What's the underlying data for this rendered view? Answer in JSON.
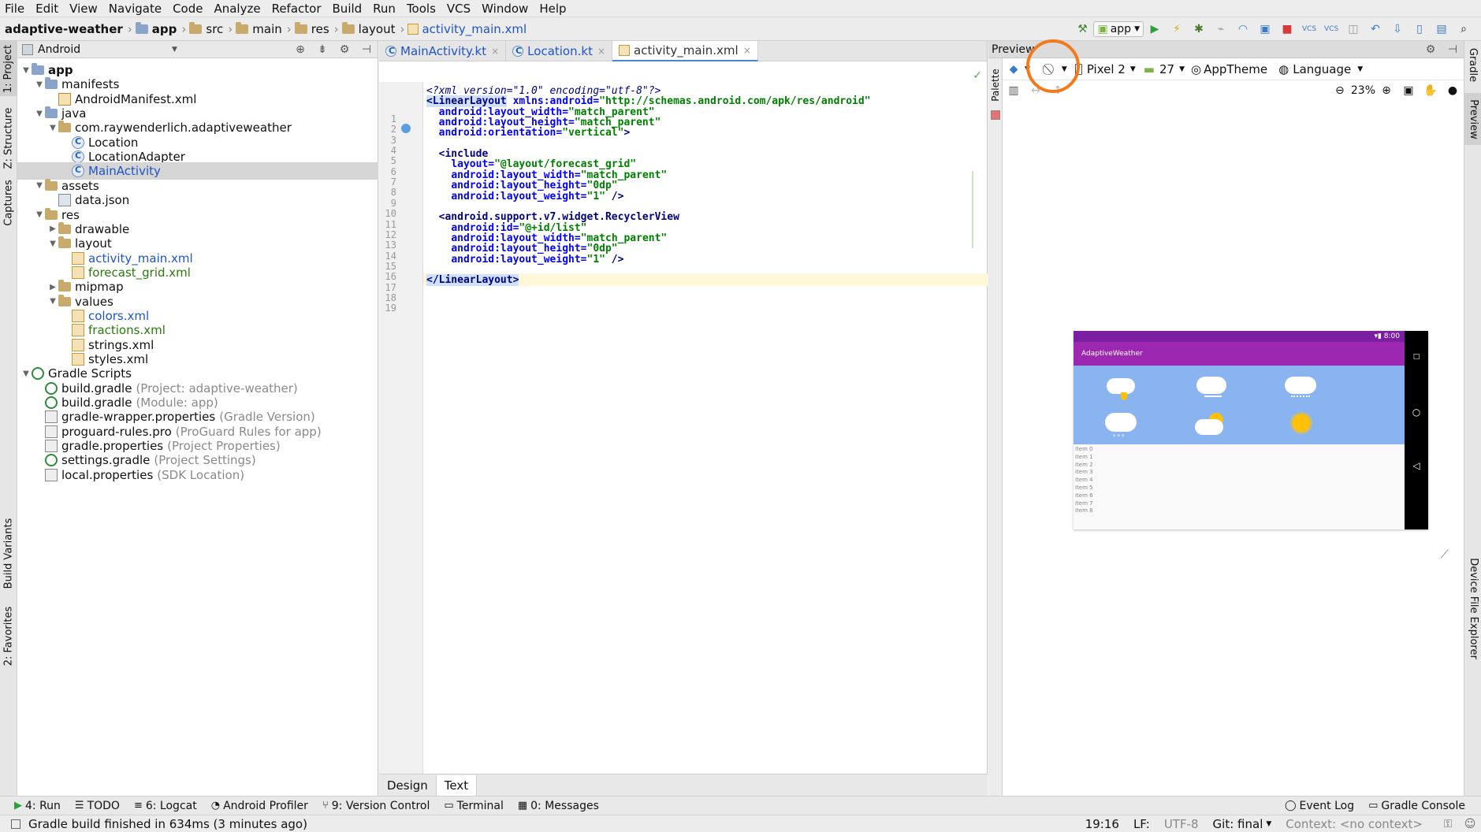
{
  "menu": [
    {
      "label": "File",
      "u": "F"
    },
    {
      "label": "Edit",
      "u": "E"
    },
    {
      "label": "View",
      "u": "V"
    },
    {
      "label": "Navigate",
      "u": "N"
    },
    {
      "label": "Code",
      "u": "C"
    },
    {
      "label": "Analyze",
      "u": "z"
    },
    {
      "label": "Refactor",
      "u": "R"
    },
    {
      "label": "Build",
      "u": "B"
    },
    {
      "label": "Run",
      "u": "u"
    },
    {
      "label": "Tools",
      "u": "T"
    },
    {
      "label": "VCS",
      "u": "S"
    },
    {
      "label": "Window",
      "u": "W"
    },
    {
      "label": "Help",
      "u": "H"
    }
  ],
  "breadcrumb": [
    "adaptive-weather",
    "app",
    "src",
    "main",
    "res",
    "layout",
    "activity_main.xml"
  ],
  "run_config": "app",
  "left_tabs": {
    "project": "1: Project",
    "structure": "Z: Structure",
    "captures": "Captures",
    "build_variants": "Build Variants",
    "favorites": "2: Favorites"
  },
  "right_tabs": {
    "gradle": "Gradle",
    "preview": "Preview",
    "device_explorer": "Device File Explorer"
  },
  "project_view": "Android",
  "tree": [
    {
      "label": "app",
      "bold": true,
      "indent": 0,
      "arrow": "▼",
      "icon": "folder-blue"
    },
    {
      "label": "manifests",
      "indent": 1,
      "arrow": "▼",
      "icon": "folder-blue"
    },
    {
      "label": "AndroidManifest.xml",
      "indent": 2,
      "icon": "manifest"
    },
    {
      "label": "java",
      "indent": 1,
      "arrow": "▼",
      "icon": "folder-blue"
    },
    {
      "label": "com.raywenderlich.adaptiveweather",
      "indent": 2,
      "arrow": "▼",
      "icon": "folder"
    },
    {
      "label": "Location",
      "indent": 3,
      "icon": "kt"
    },
    {
      "label": "LocationAdapter",
      "indent": 3,
      "icon": "kt"
    },
    {
      "label": "MainActivity",
      "indent": 3,
      "icon": "kt",
      "selected": true,
      "color": "blue"
    },
    {
      "label": "assets",
      "indent": 1,
      "arrow": "▼",
      "icon": "folder"
    },
    {
      "label": "data.json",
      "indent": 2,
      "icon": "json"
    },
    {
      "label": "res",
      "indent": 1,
      "arrow": "▼",
      "icon": "folder"
    },
    {
      "label": "drawable",
      "indent": 2,
      "arrow": "▶",
      "icon": "folder"
    },
    {
      "label": "layout",
      "indent": 2,
      "arrow": "▼",
      "icon": "folder"
    },
    {
      "label": "activity_main.xml",
      "indent": 3,
      "icon": "xml",
      "color": "blue"
    },
    {
      "label": "forecast_grid.xml",
      "indent": 3,
      "icon": "xml",
      "color": "green"
    },
    {
      "label": "mipmap",
      "indent": 2,
      "arrow": "▶",
      "icon": "folder"
    },
    {
      "label": "values",
      "indent": 2,
      "arrow": "▼",
      "icon": "folder"
    },
    {
      "label": "colors.xml",
      "indent": 3,
      "icon": "xml",
      "color": "blue"
    },
    {
      "label": "fractions.xml",
      "indent": 3,
      "icon": "xml",
      "color": "green"
    },
    {
      "label": "strings.xml",
      "indent": 3,
      "icon": "xml"
    },
    {
      "label": "styles.xml",
      "indent": 3,
      "icon": "xml"
    },
    {
      "label": "Gradle Scripts",
      "indent": 0,
      "arrow": "▼",
      "icon": "gradle"
    },
    {
      "label": "build.gradle",
      "hint": "(Project: adaptive-weather)",
      "indent": 1,
      "icon": "gradle"
    },
    {
      "label": "build.gradle",
      "hint": "(Module: app)",
      "indent": 1,
      "icon": "gradle"
    },
    {
      "label": "gradle-wrapper.properties",
      "hint": "(Gradle Version)",
      "indent": 1,
      "icon": "prop"
    },
    {
      "label": "proguard-rules.pro",
      "hint": "(ProGuard Rules for app)",
      "indent": 1,
      "icon": "prop"
    },
    {
      "label": "gradle.properties",
      "hint": "(Project Properties)",
      "indent": 1,
      "icon": "prop"
    },
    {
      "label": "settings.gradle",
      "hint": "(Project Settings)",
      "indent": 1,
      "icon": "gradle"
    },
    {
      "label": "local.properties",
      "hint": "(SDK Location)",
      "indent": 1,
      "icon": "prop"
    }
  ],
  "editor_tabs": [
    {
      "label": "MainActivity.kt",
      "active": false
    },
    {
      "label": "Location.kt",
      "active": false
    },
    {
      "label": "activity_main.xml",
      "active": true
    }
  ],
  "code": [
    [
      [
        "pi",
        "<?xml version=\"1.0\" encoding=\"utf-8\"?>"
      ]
    ],
    [
      [
        "tagh",
        "<LinearLayout"
      ],
      [
        "sp",
        " "
      ],
      [
        "attr",
        "xmlns:android="
      ],
      [
        "val",
        "\"http://schemas.android.com/apk/res/android\""
      ]
    ],
    [
      [
        "sp",
        "  "
      ],
      [
        "attr",
        "android:layout_width="
      ],
      [
        "val",
        "\"match_parent\""
      ]
    ],
    [
      [
        "sp",
        "  "
      ],
      [
        "attr",
        "android:layout_height="
      ],
      [
        "val",
        "\"match_parent\""
      ]
    ],
    [
      [
        "sp",
        "  "
      ],
      [
        "attr",
        "android:orientation="
      ],
      [
        "val",
        "\"vertical\""
      ],
      [
        "tag",
        ">"
      ]
    ],
    [],
    [
      [
        "sp",
        "  "
      ],
      [
        "tag",
        "<include"
      ]
    ],
    [
      [
        "sp",
        "    "
      ],
      [
        "attr",
        "layout="
      ],
      [
        "val",
        "\"@layout/forecast_grid\""
      ]
    ],
    [
      [
        "sp",
        "    "
      ],
      [
        "attr",
        "android:layout_width="
      ],
      [
        "val",
        "\"match_parent\""
      ]
    ],
    [
      [
        "sp",
        "    "
      ],
      [
        "attr",
        "android:layout_height="
      ],
      [
        "val",
        "\"0dp\""
      ]
    ],
    [
      [
        "sp",
        "    "
      ],
      [
        "attr",
        "android:layout_weight="
      ],
      [
        "val",
        "\"1\""
      ],
      [
        "tag",
        " />"
      ]
    ],
    [],
    [
      [
        "sp",
        "  "
      ],
      [
        "tag",
        "<android.support.v7.widget.RecyclerView"
      ]
    ],
    [
      [
        "sp",
        "    "
      ],
      [
        "attr",
        "android:id="
      ],
      [
        "val",
        "\"@+id/list\""
      ]
    ],
    [
      [
        "sp",
        "    "
      ],
      [
        "attr",
        "android:layout_width="
      ],
      [
        "val",
        "\"match_parent\""
      ]
    ],
    [
      [
        "sp",
        "    "
      ],
      [
        "attr",
        "android:layout_height="
      ],
      [
        "val",
        "\"0dp\""
      ]
    ],
    [
      [
        "sp",
        "    "
      ],
      [
        "attr",
        "android:layout_weight="
      ],
      [
        "val",
        "\"1\""
      ],
      [
        "tag",
        " />"
      ]
    ],
    [],
    [
      [
        "tagh",
        "</LinearLayout>"
      ]
    ]
  ],
  "editor_bottom_tabs": [
    {
      "label": "Design",
      "active": false
    },
    {
      "label": "Text",
      "active": true
    }
  ],
  "preview": {
    "title": "Preview",
    "palette": "Palette",
    "device": "Pixel 2",
    "api": "27",
    "theme": "AppTheme",
    "language": "Language",
    "zoom": "23%",
    "phone_time": "8:00",
    "app_title": "AdaptiveWeather",
    "items": [
      "Item 0",
      "Item 1",
      "Item 2",
      "Item 3",
      "Item 4",
      "Item 5",
      "Item 6",
      "Item 7",
      "Item 8"
    ]
  },
  "bottom_tools": [
    {
      "key": "run",
      "label": "4: Run",
      "icon": "▶"
    },
    {
      "key": "todo",
      "label": "TODO",
      "icon": "☰"
    },
    {
      "key": "logcat",
      "label": "6: Logcat",
      "icon": "≡"
    },
    {
      "key": "profiler",
      "label": "Android Profiler",
      "icon": "◔"
    },
    {
      "key": "vcs",
      "label": "9: Version Control",
      "icon": "⑂"
    },
    {
      "key": "terminal",
      "label": "Terminal",
      "icon": "▭"
    },
    {
      "key": "messages",
      "label": "0: Messages",
      "icon": "▦"
    }
  ],
  "bottom_right_tools": [
    {
      "key": "eventlog",
      "label": "Event Log",
      "icon": "◯"
    },
    {
      "key": "gradleconsole",
      "label": "Gradle Console",
      "icon": "▭"
    }
  ],
  "status": {
    "message": "Gradle build finished in 634ms (3 minutes ago)",
    "position": "19:16",
    "line_sep": "LF:",
    "encoding": "UTF-8",
    "git": "Git: final",
    "context": "Context: <no context>"
  },
  "colors": {
    "accent_circle": "#f27a1c",
    "app_primary": "#9c27b0",
    "grid_bg": "#8ab4f0"
  }
}
